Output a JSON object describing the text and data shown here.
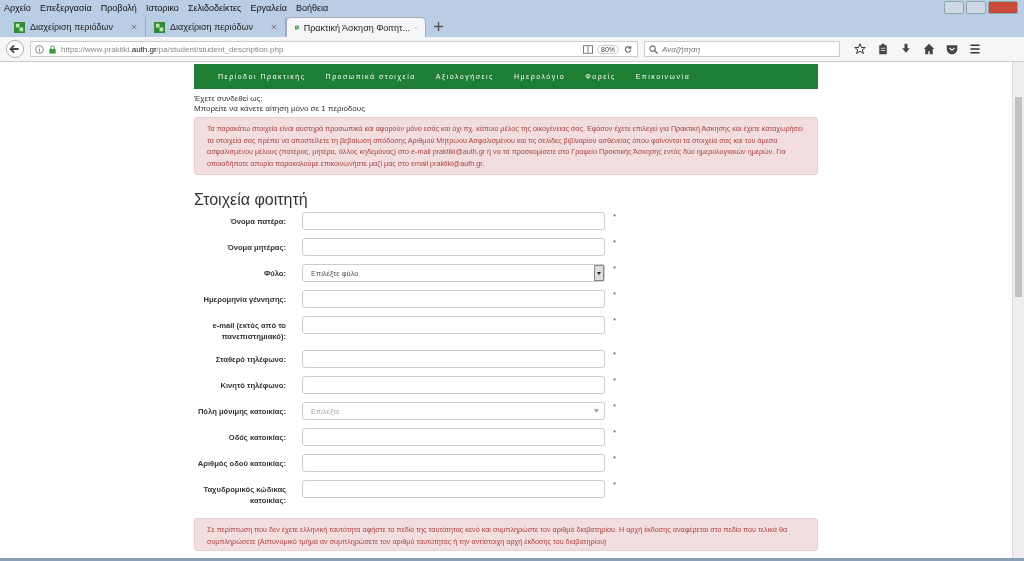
{
  "menu_bar": [
    "Αρχείο",
    "Επεξεργασία",
    "Προβολή",
    "Ιστορικο",
    "Σελιδοδείκτες",
    "Εργαλεία",
    "Βοήθεια"
  ],
  "tabs": [
    {
      "label": "Διαχείριση περιόδων",
      "selected": false
    },
    {
      "label": "Διαχείριση περιόδων",
      "selected": false
    },
    {
      "label": "Πρακτική Άσκηση Φοιτητ...",
      "selected": true
    }
  ],
  "address_bar": {
    "prefix": "https://www.praktiki.",
    "domain": "auth.gr",
    "path": "/pa/student/student_description.php",
    "zoom": "80%"
  },
  "search": {
    "placeholder": "Αναζήτηση"
  },
  "site_nav": [
    "Περίοδοι Πρακτικής",
    "Προσωπικά στοιχεία",
    "Αξιολογήσεις",
    "Ημερολόγιο",
    "Φορείς",
    "Επικοινωνία"
  ],
  "login_notice": [
    "Έχετε συνδεθεί ως:",
    "Μπορείτε να κάνετε αίτηση μόνο σε 1 περιόδους"
  ],
  "alert_top": "Τα παρακάτω στοιχεία είναι αυστηρά προσωπικά και αφορούν μόνο εσάς και όχι πχ. κάποιο μέλος της οικογένειας σας. Εφόσον έχετε επιλεγεί για Πρακτική Άσκησης και έχετε καταχωρήσει τα στοιχεία σας πρέπει να αποστείλετε τη βεβαίωση απόδοσης Αριθμού Μητρώου Ασφαλισμένου και τις σελίδες βιβλιαρίου ασθενείας όπου φαίνονται τα στοιχεία σας και του άμεσα ασφαλισμένου μέλους (πατέρας, μητέρα, άλλος κηδεμόνας) στο e-mail praktiki@auth.gr ή να τα προσκομίσετε στο Γραφείο Πρακτικής Άσκησης εντός δύο ημερολογιακών ημερών. Για οποιαδήποτε απορία παρακαλούμε επικοινωνήστε μαζί μας στο email praktiki@auth.gr.",
  "section_title": "Στοιχεία φοιτητή",
  "fields": [
    {
      "kind": "text",
      "label": "Όνομα πατέρα:",
      "required": "*"
    },
    {
      "kind": "text",
      "label": "Όνομα μητέρας:",
      "required": "*"
    },
    {
      "kind": "dropdown",
      "label": "Φύλο:",
      "placeholder": "Επιλέξτε φύλο",
      "required": "*"
    },
    {
      "kind": "text",
      "label": "Ημερομηνία γέννησης:",
      "required": "*"
    },
    {
      "kind": "text",
      "label": "e-mail (εκτός από το πανεπιστημιακό):",
      "required": "*"
    },
    {
      "kind": "text",
      "label": "Σταθερό τηλέφωνο:",
      "required": "*"
    },
    {
      "kind": "text",
      "label": "Κινητό τηλέφωνο:",
      "required": "*"
    },
    {
      "kind": "select",
      "label": "Πόλη μόνιμης κατοικίας:",
      "placeholder": "Επιλέξτε",
      "required": "*"
    },
    {
      "kind": "text",
      "label": "Οδός κατοικίας:",
      "required": "*"
    },
    {
      "kind": "text",
      "label": "Αριθμός οδού κατοικίας:",
      "required": "*"
    },
    {
      "kind": "text",
      "label": "Ταχυδρομικός κώδικας κατοικίας:",
      "required": "*"
    }
  ],
  "alert_bottom": "Σε περίπτωση που δεν έχετε ελληνική ταυτότητα αφήστε το πεδίο της ταυτότητας κενό και συμπληρώστε τον αριθμό διαβατηρίου. Η αρχή έκδοσης αναφέρεται στο πεδίο που τελικά θα συμπληρώσετε (Αστυνομικό τμήμα αν συμπληρώσετε τον αριθμό ταυτότητας ή την αντίστοιχη αρχή έκδοσης του διαβατηρίου)"
}
